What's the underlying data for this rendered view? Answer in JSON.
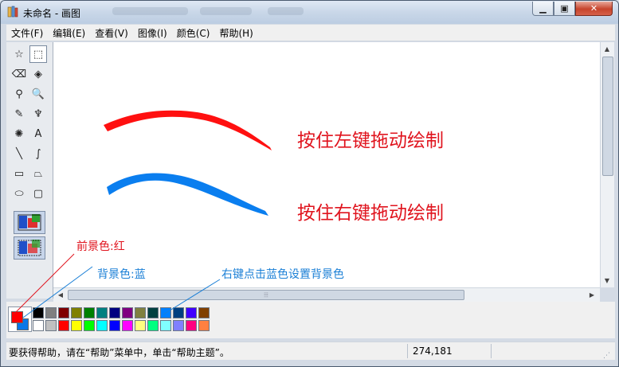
{
  "window": {
    "title": "未命名 - 画图"
  },
  "menu": [
    "文件(F)",
    "编辑(E)",
    "查看(V)",
    "图像(I)",
    "颜色(C)",
    "帮助(H)"
  ],
  "tools": [
    {
      "name": "free-select-icon",
      "glyph": "☆"
    },
    {
      "name": "rect-select-icon",
      "glyph": "⬚"
    },
    {
      "name": "eraser-icon",
      "glyph": "⌫"
    },
    {
      "name": "fill-bucket-icon",
      "glyph": "◈"
    },
    {
      "name": "color-picker-icon",
      "glyph": "⚲"
    },
    {
      "name": "magnifier-icon",
      "glyph": "🔍"
    },
    {
      "name": "pencil-icon",
      "glyph": "✎"
    },
    {
      "name": "brush-icon",
      "glyph": "♆"
    },
    {
      "name": "airbrush-icon",
      "glyph": "✺"
    },
    {
      "name": "text-icon",
      "glyph": "A"
    },
    {
      "name": "line-icon",
      "glyph": "╲"
    },
    {
      "name": "curve-icon",
      "glyph": "∫"
    },
    {
      "name": "rectangle-icon",
      "glyph": "▭"
    },
    {
      "name": "polygon-icon",
      "glyph": "⏢"
    },
    {
      "name": "ellipse-icon",
      "glyph": "⬭"
    },
    {
      "name": "rounded-rect-icon",
      "glyph": "▢"
    }
  ],
  "canvas": {
    "text_red": "按住左键拖动绘制",
    "text_blue": "按住右键拖动绘制"
  },
  "annotations": {
    "fg": "前景色:红",
    "bg": "背景色:蓝",
    "tip": "右键点击蓝色设置背景色"
  },
  "colors": {
    "foreground": "#ff0000",
    "background": "#0a78e8",
    "annot_red": "#e0141e",
    "annot_blue": "#1a7fd6",
    "palette_row1": [
      "#000000",
      "#808080",
      "#800000",
      "#808000",
      "#008000",
      "#008080",
      "#000080",
      "#800080",
      "#808040",
      "#004040",
      "#0080ff",
      "#004080",
      "#4000ff",
      "#804000"
    ],
    "palette_row2": [
      "#ffffff",
      "#c0c0c0",
      "#ff0000",
      "#ffff00",
      "#00ff00",
      "#00ffff",
      "#0000ff",
      "#ff00ff",
      "#ffff80",
      "#00ff80",
      "#80ffff",
      "#8080ff",
      "#ff0080",
      "#ff8040"
    ]
  },
  "status": {
    "help": "要获得帮助，请在“帮助”菜单中，单击“帮助主题”。",
    "coords": "274,181"
  }
}
